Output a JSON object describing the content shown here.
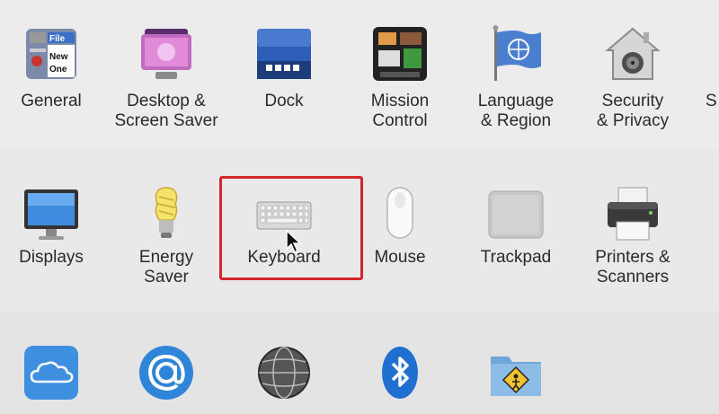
{
  "sections": {
    "personal": {
      "items": [
        {
          "id": "general",
          "label": "General",
          "icon": "general-icon",
          "icon_text_1": "File",
          "icon_text_2": "New",
          "icon_text_3": "One"
        },
        {
          "id": "desktop",
          "label": "Desktop &\nScreen Saver",
          "icon": "desktop-screensaver-icon"
        },
        {
          "id": "dock",
          "label": "Dock",
          "icon": "dock-icon"
        },
        {
          "id": "mission",
          "label": "Mission\nControl",
          "icon": "mission-control-icon"
        },
        {
          "id": "language",
          "label": "Language\n& Region",
          "icon": "language-region-icon"
        },
        {
          "id": "security",
          "label": "Security\n& Privacy",
          "icon": "security-privacy-icon"
        },
        {
          "id": "spotlight",
          "label": "S",
          "icon": "spotlight-icon"
        }
      ]
    },
    "hardware": {
      "items": [
        {
          "id": "displays",
          "label": "Displays",
          "icon": "displays-icon"
        },
        {
          "id": "energy",
          "label": "Energy\nSaver",
          "icon": "energy-saver-icon"
        },
        {
          "id": "keyboard",
          "label": "Keyboard",
          "icon": "keyboard-icon",
          "highlighted": true
        },
        {
          "id": "mouse",
          "label": "Mouse",
          "icon": "mouse-icon"
        },
        {
          "id": "trackpad",
          "label": "Trackpad",
          "icon": "trackpad-icon"
        },
        {
          "id": "printers",
          "label": "Printers &\nScanners",
          "icon": "printers-scanners-icon"
        }
      ]
    },
    "internet": {
      "items": [
        {
          "id": "icloud",
          "icon": "icloud-icon"
        },
        {
          "id": "internet-accounts",
          "icon": "internet-accounts-icon"
        },
        {
          "id": "network",
          "icon": "network-icon"
        },
        {
          "id": "bluetooth",
          "icon": "bluetooth-icon"
        },
        {
          "id": "sharing",
          "icon": "sharing-icon"
        }
      ]
    }
  },
  "colors": {
    "highlight_border": "#d4262b",
    "background": "#ececec",
    "label_text": "#2a2a2a"
  }
}
